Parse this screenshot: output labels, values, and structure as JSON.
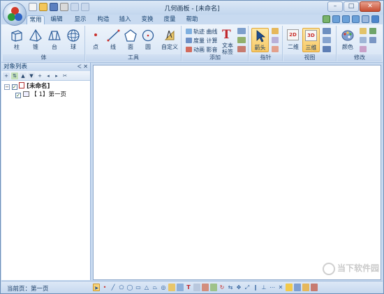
{
  "window": {
    "title": "几何画板 - [未命名]",
    "controls": {
      "minimize": "–",
      "maximize": "□",
      "close": "✕"
    }
  },
  "tabs": [
    "常用",
    "编辑",
    "显示",
    "构造",
    "插入",
    "变换",
    "度量",
    "帮助"
  ],
  "ribbon": {
    "solids": {
      "group_label": "体",
      "items": [
        "柱",
        "锥",
        "台",
        "球"
      ]
    },
    "tools": {
      "group_label": "工具",
      "items": [
        "点",
        "线",
        "面",
        "圆",
        "自定义"
      ]
    },
    "add": {
      "group_label": "添加",
      "rows": [
        "轨迹 曲线",
        "度量 计算",
        "动画 影音"
      ],
      "text_button": "文本\n标签",
      "text_button_line1": "文本",
      "text_button_line2": "标签",
      "text_glyph": "T"
    },
    "pointer": {
      "group_label": "指针",
      "arrow_label": "箭头"
    },
    "view": {
      "group_label": "视图",
      "items": [
        "二维",
        "三维"
      ],
      "badge_2d": "2D",
      "badge_3d": "3D"
    },
    "modify": {
      "group_label": "修改",
      "color_label": "颜色"
    }
  },
  "object_panel": {
    "title": "对象列表",
    "header_icons": "ᐸ ✕",
    "tree": [
      {
        "label": "[未命名]",
        "checked": true
      },
      {
        "label": "【 1】第一页",
        "checked": true
      }
    ]
  },
  "status": {
    "current_page": "当前页：第一页"
  },
  "watermark": {
    "text": "当下软件园"
  },
  "colors": {
    "accent": "#1e5aa0",
    "ribbon_bg": "#dbe7f6",
    "frame": "#c8daf0",
    "highlight": "#f8c965"
  }
}
